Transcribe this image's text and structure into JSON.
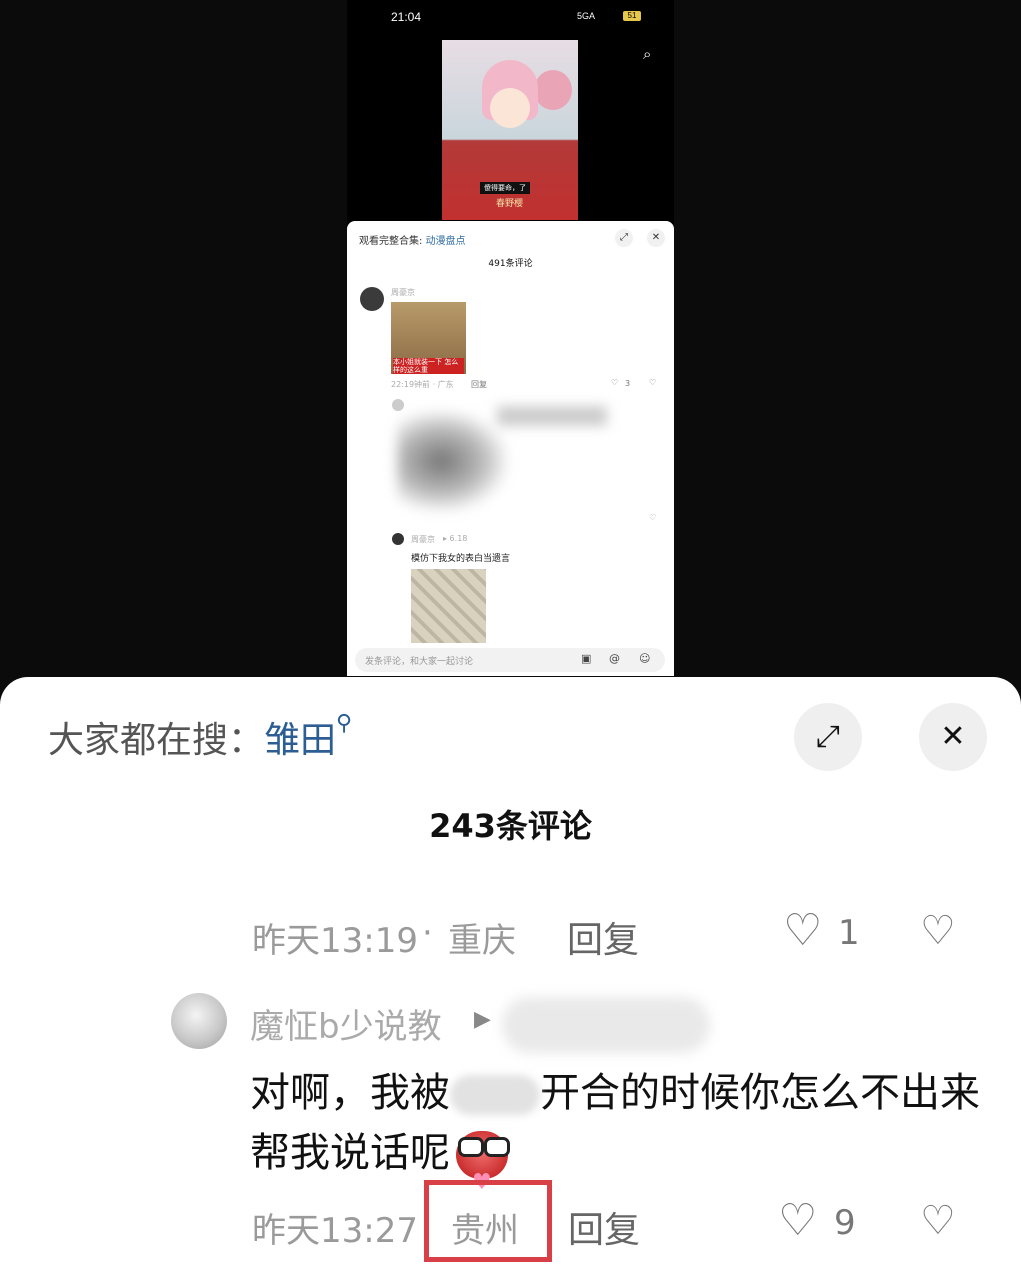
{
  "phone_screenshot": {
    "status": {
      "time": "21:04",
      "network": "5GA",
      "battery": "51"
    },
    "cover_subtitle": [
      "傻得要命，了",
      "春野樱"
    ],
    "sheet": {
      "header_prefix": "观看完整合集:",
      "header_keyword": "动漫盘点",
      "comment_count": "491条评论",
      "comment1": {
        "user": "周豪京",
        "image_caption": "本小姐就装一下 怎么样的这么重",
        "meta": "22:19钟前 · 广东",
        "reply": "回复",
        "likes": "3"
      },
      "reply_user": "周豪京",
      "reply_tag": "▸ 6.18",
      "reply_text": "模仿下我女的表白当遗言",
      "input_placeholder": "发条评论，和大家一起讨论"
    }
  },
  "main_sheet": {
    "search_prefix": "大家都在搜：",
    "search_keyword": "雏田",
    "comment_count": "243条评论",
    "comment1": {
      "time": "昨天13:19",
      "separator": "·",
      "location": "重庆",
      "reply": "回复",
      "likes": "1"
    },
    "comment2": {
      "user": "魔怔b少说教",
      "text_part1": "对啊，我被",
      "text_part2": "开合的时候你怎么不出来帮我说话呢",
      "time": "昨天13:27",
      "location": "贵州",
      "reply": "回复",
      "likes": "9"
    }
  },
  "icons": {
    "search": "search-icon",
    "expand": "expand-icon",
    "close": "close-icon",
    "heart": "heart-icon",
    "dislike": "broken-heart-icon"
  },
  "colors": {
    "keyword": "#2c5e93",
    "highlight_box": "#d93f47"
  }
}
